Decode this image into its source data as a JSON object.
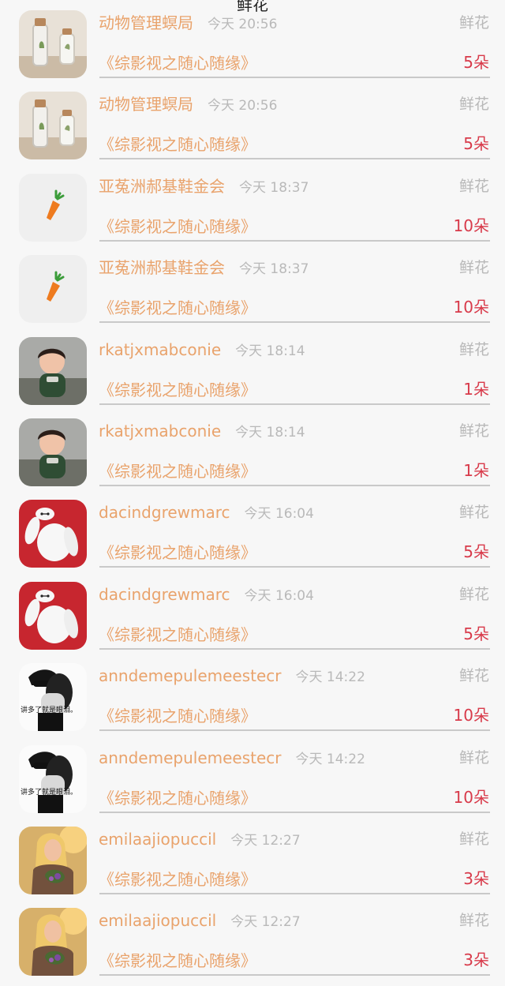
{
  "header": {
    "title": "鲜花"
  },
  "items": [
    {
      "avatar": "jar",
      "name": "动物管理螟局",
      "time": "今天 20:56",
      "type": "鲜花",
      "title": "《综影视之随心随缘》",
      "count": "5朵"
    },
    {
      "avatar": "jar",
      "name": "动物管理螟局",
      "time": "今天 20:56",
      "type": "鲜花",
      "title": "《综影视之随心随缘》",
      "count": "5朵"
    },
    {
      "avatar": "carrot",
      "name": "亚菟洲郝基鞋金会",
      "time": "今天 18:37",
      "type": "鲜花",
      "title": "《综影视之随心随缘》",
      "count": "10朵"
    },
    {
      "avatar": "carrot",
      "name": "亚菟洲郝基鞋金会",
      "time": "今天 18:37",
      "type": "鲜花",
      "title": "《综影视之随心随缘》",
      "count": "10朵"
    },
    {
      "avatar": "kid",
      "name": "rkatjxmabconie",
      "time": "今天 18:14",
      "type": "鲜花",
      "title": "《综影视之随心随缘》",
      "count": "1朵"
    },
    {
      "avatar": "kid",
      "name": "rkatjxmabconie",
      "time": "今天 18:14",
      "type": "鲜花",
      "title": "《综影视之随心随缘》",
      "count": "1朵"
    },
    {
      "avatar": "baymax",
      "name": "dacindgrewmarc",
      "time": "今天 16:04",
      "type": "鲜花",
      "title": "《综影视之随心随缘》",
      "count": "5朵"
    },
    {
      "avatar": "baymax",
      "name": "dacindgrewmarc",
      "time": "今天 16:04",
      "type": "鲜花",
      "title": "《综影视之随心随缘》",
      "count": "5朵"
    },
    {
      "avatar": "mono",
      "avatar_text": "讲多了就是眼泪。",
      "name": "anndemepulemeestecr",
      "time": "今天 14:22",
      "type": "鲜花",
      "title": "《综影视之随心随缘》",
      "count": "10朵"
    },
    {
      "avatar": "mono",
      "avatar_text": "讲多了就是眼泪。",
      "name": "anndemepulemeestecr",
      "time": "今天 14:22",
      "type": "鲜花",
      "title": "《综影视之随心随缘》",
      "count": "10朵"
    },
    {
      "avatar": "blonde",
      "name": "emilaajiopuccil",
      "time": "今天 12:27",
      "type": "鲜花",
      "title": "《综影视之随心随缘》",
      "count": "3朵"
    },
    {
      "avatar": "blonde",
      "name": "emilaajiopuccil",
      "time": "今天 12:27",
      "type": "鲜花",
      "title": "《综影视之随心随缘》",
      "count": "3朵"
    }
  ],
  "colors": {
    "name": "#e9a36c",
    "count": "#d83a4a",
    "muted": "#b8b8b8"
  }
}
